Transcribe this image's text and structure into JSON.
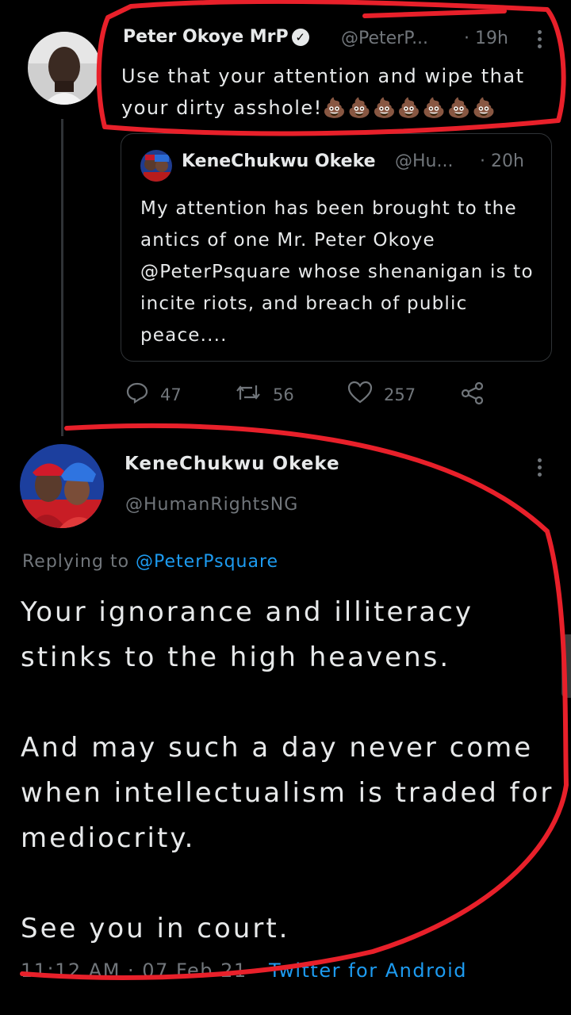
{
  "tweet1": {
    "name": "Peter Okoye MrP",
    "handle": "@PeterP...",
    "time": "· 19h",
    "text": "Use that your attention and wipe that your dirty asshole!💩💩💩💩💩💩💩"
  },
  "quote": {
    "name": "KeneChukwu Okeke",
    "handle": "@Hu...",
    "time": "· 20h",
    "text": "My attention has been brought to the antics of one Mr. Peter Okoye @PeterPsquare whose shenanigan is to incite riots, and breach of public peace...."
  },
  "actions": {
    "replies": "47",
    "retweets": "56",
    "likes": "257"
  },
  "main_tweet": {
    "name": "KeneChukwu Okeke",
    "handle": "@HumanRightsNG",
    "replying_prefix": "Replying to",
    "replying_to": "@PeterPsquare",
    "paragraph1": "Your ignorance and illiteracy stinks to the high heavens.",
    "paragraph2": "And may such a day never come when intellectualism is traded for mediocrity.",
    "paragraph3": "See you in court.",
    "timestamp": "11:12 AM · 07 Feb 21 ·",
    "source": "Twitter for Android"
  },
  "colors": {
    "background": "#000000",
    "link": "#1d9bf0",
    "annotation": "#e8202a"
  }
}
